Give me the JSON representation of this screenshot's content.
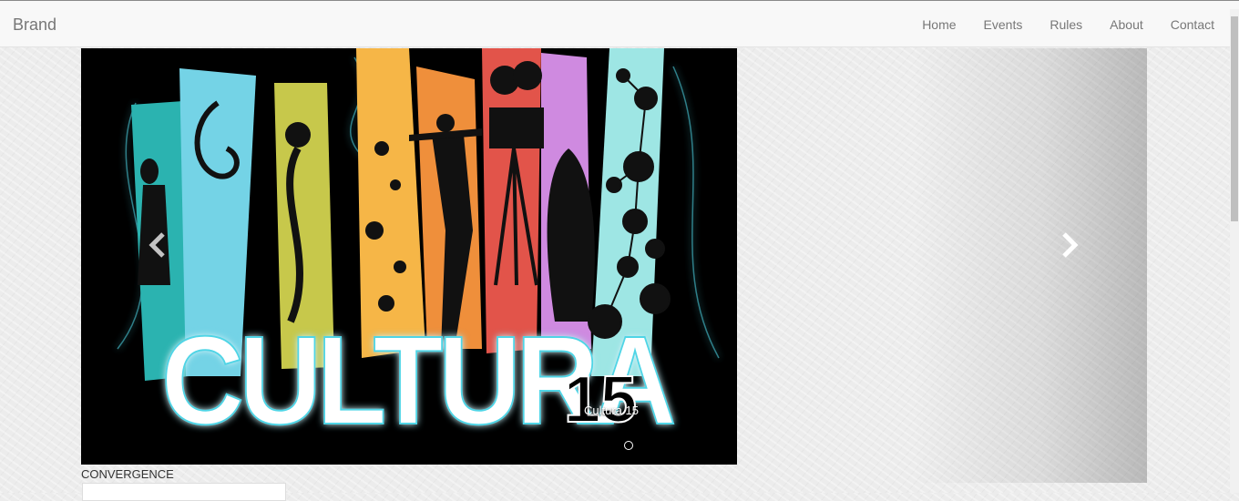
{
  "navbar": {
    "brand": "Brand",
    "links": [
      "Home",
      "Events",
      "Rules",
      "About",
      "Contact"
    ]
  },
  "carousel": {
    "slide_title": "CULTURA",
    "slide_number": "15",
    "caption": "Cultura 15",
    "controls": {
      "prev_icon": "chevron-left-icon",
      "next_icon": "chevron-right-icon"
    }
  },
  "section": {
    "label": "CONVERGENCE"
  },
  "colors": {
    "navbar_bg": "#f8f8f8",
    "nav_text": "#777777",
    "slide_bg": "#000000",
    "stripes": [
      "#2bb3b0",
      "#74d3e6",
      "#c7c84b",
      "#f6b647",
      "#ef8f3b",
      "#e2544a",
      "#cf8ae0",
      "#9ee6e4"
    ]
  }
}
